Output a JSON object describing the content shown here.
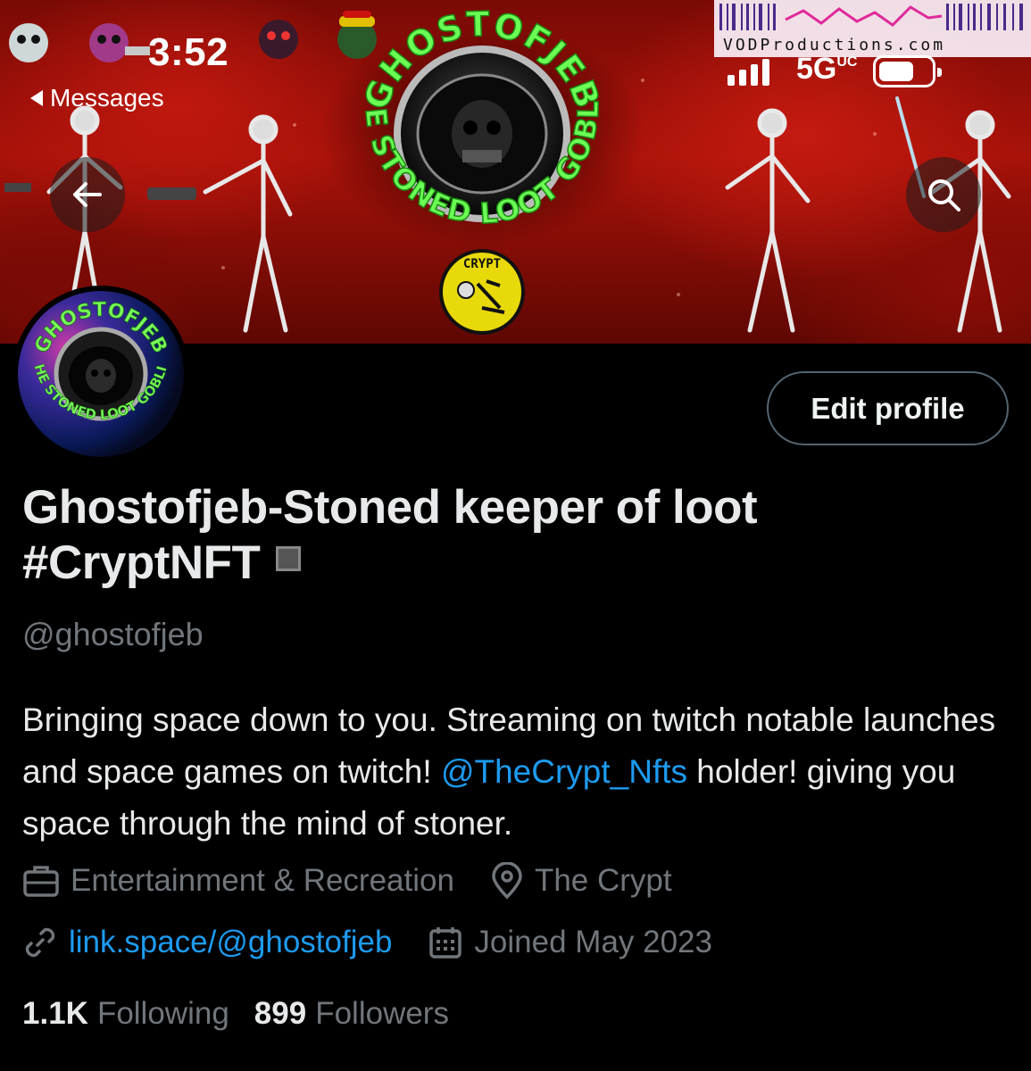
{
  "status_bar": {
    "time": "3:52",
    "back_label": "Messages",
    "network": "5G",
    "network_sup": "UC"
  },
  "watermark": {
    "text": "VODProductions.com"
  },
  "banner": {
    "ring_text_top": "GHOSTOFJEB",
    "ring_text_bottom": "THE STONED LOOT GOBLIN",
    "badge_text": "CRYPT"
  },
  "avatar": {
    "ring_text_top": "GHOSTOFJEB",
    "ring_text_bottom": "THE STONED LOOT GOBLIN"
  },
  "profile": {
    "edit_label": "Edit profile",
    "display_name_line1": "Ghostofjeb-Stoned keeper of loot",
    "display_name_line2": "#CryptNFT",
    "handle": "@ghostofjeb",
    "bio_part1": "Bringing space down to you. Streaming on twitch notable launches and space games on twitch! ",
    "bio_mention": "@TheCrypt_Nfts",
    "bio_part2": " holder! giving you space through the mind of stoner.",
    "category": "Entertainment & Recreation",
    "location": "The Crypt",
    "link": "link.space/@ghostofjeb",
    "joined": "Joined May 2023",
    "following_count": "1.1K",
    "following_label": "Following",
    "followers_count": "899",
    "followers_label": "Followers"
  },
  "icons": [
    "back-arrow-icon",
    "search-icon",
    "briefcase-icon",
    "location-pin-icon",
    "link-icon",
    "calendar-icon"
  ],
  "colors": {
    "accent": "#1d9bf0",
    "muted": "#71767b",
    "text": "#e7e9ea",
    "banner_red": "#b3150c",
    "ring_green": "#4cff3a"
  }
}
